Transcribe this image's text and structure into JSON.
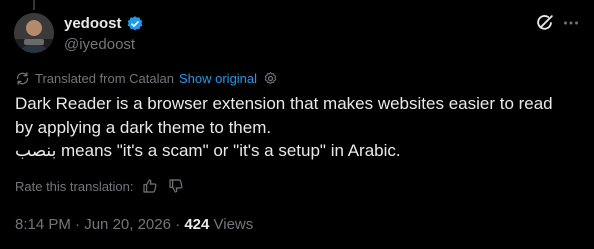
{
  "author": {
    "display_name": "yedoost",
    "handle": "@iyedoost",
    "verified": true
  },
  "icons": {
    "verified": "verified-badge-icon",
    "grok": "grok-icon",
    "more": "more-dots-icon",
    "translate": "translate-icon",
    "settings": "settings-gear-icon",
    "thumbs_up": "thumbs-up-icon",
    "thumbs_down": "thumbs-down-icon"
  },
  "translation": {
    "label": "Translated from Catalan",
    "show_original": "Show original"
  },
  "tweet": {
    "line1": "Dark Reader is a browser extension that makes websites easier to read",
    "line2": "by applying a dark theme to them.",
    "line3_arabic": "بنصب",
    "line3_rest": " means \"it's a scam\" or \"it's a setup\" in Arabic."
  },
  "rate": {
    "label": "Rate this translation:"
  },
  "meta": {
    "time": "8:14 PM",
    "separator": " · ",
    "date": "Jun 20, 2026",
    "separator2": " · ",
    "views_count": "424",
    "views_label": " Views"
  },
  "colors": {
    "background": "#000000",
    "text": "#e7e9ea",
    "muted": "#71767b",
    "accent": "#1d9bf0"
  }
}
